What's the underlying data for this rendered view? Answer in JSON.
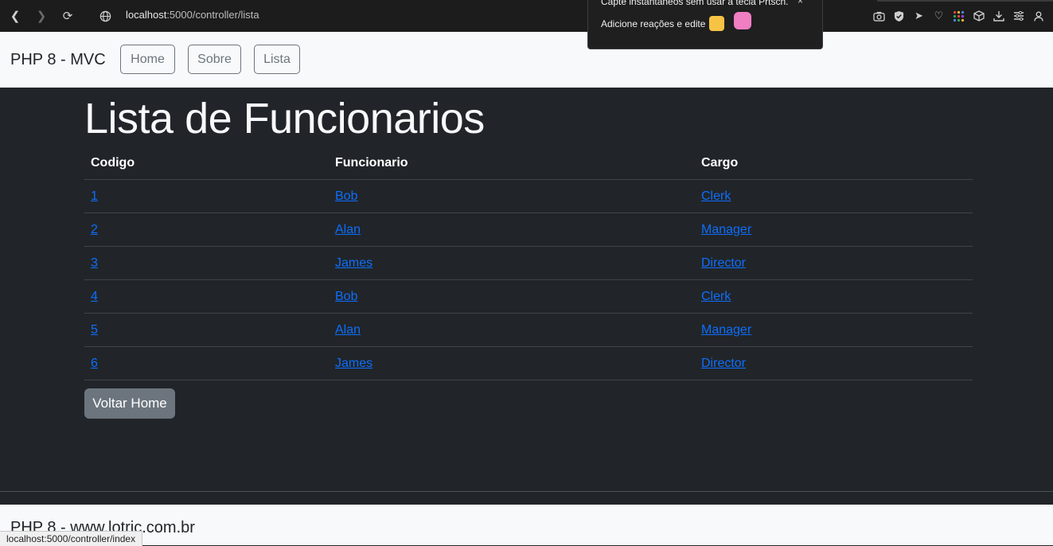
{
  "browser": {
    "url_host": "localhost",
    "url_path": ":5000/controller/lista",
    "status_url": "localhost:5000/controller/index",
    "toolbar_icons": [
      "camera-icon",
      "shield-icon",
      "send-icon",
      "heart-icon",
      "apps-icon",
      "box-icon",
      "download-icon",
      "menu-icon",
      "profile-icon"
    ]
  },
  "popup": {
    "line1": "Capte instantâneos sem usar a tecla Prtscn.",
    "line2": "Adicione reações e edite",
    "close": "×"
  },
  "navbar": {
    "brand": "PHP 8 - MVC",
    "links": [
      "Home",
      "Sobre",
      "Lista"
    ]
  },
  "page": {
    "title": "Lista de Funcionarios",
    "headers": [
      "Codigo",
      "Funcionario",
      "Cargo"
    ],
    "rows": [
      [
        "1",
        "Bob",
        "Clerk"
      ],
      [
        "2",
        "Alan",
        "Manager"
      ],
      [
        "3",
        "James",
        "Director"
      ],
      [
        "4",
        "Bob",
        "Clerk"
      ],
      [
        "5",
        "Alan",
        "Manager"
      ],
      [
        "6",
        "James",
        "Director"
      ]
    ],
    "back_button": "Voltar Home"
  },
  "footer": {
    "text": "PHP 8 - www.lotric.com.br"
  },
  "colors": {
    "background": "#212529",
    "link": "#0d6efd",
    "button": "#6c757d",
    "navbar": "#f8f9fa"
  }
}
